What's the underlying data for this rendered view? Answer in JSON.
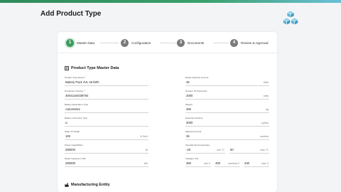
{
  "page": {
    "title": "Add Product Type"
  },
  "colors": {
    "accent": "#3d9b5f",
    "inactive_step": "#7a7a7a",
    "logo": "#5fb3d3"
  },
  "logo": {
    "icon": "cubes-icon"
  },
  "steps": [
    {
      "number": "1",
      "label": "Master Data",
      "active": true
    },
    {
      "number": "2",
      "label": "Configuration",
      "active": false
    },
    {
      "number": "3",
      "label": "Documents",
      "active": false
    },
    {
      "number": "4",
      "label": "Review & Approval",
      "active": false
    }
  ],
  "master_section": {
    "title": "Product Type Master Data",
    "icon": "grid-icon"
  },
  "fields": {
    "product_type_name": {
      "label": "Product Type Name *",
      "value": "Battery Pack 4VL 45 kWh"
    },
    "production_number": {
      "label": "Production Number *",
      "value": "30041164038784"
    },
    "battery_application_type": {
      "label": "Battery Application Type",
      "value": "Automotive"
    },
    "battery_chemistry_type": {
      "label": "Battery Chemistry Type",
      "value": "Li"
    },
    "state_of_health": {
      "label": "State Of Health",
      "value": "100",
      "unit": "% SoH"
    },
    "power_capabilities": {
      "label": "Power Capabilities",
      "value": "280000",
      "unit": "W"
    },
    "rated_capacity": {
      "label": "Rated Capacity in Wh",
      "value": "280000",
      "unit": "Wh"
    },
    "rated_capacity_current": {
      "label": "Rated Capacity Current",
      "value": "45",
      "unit": "kWh"
    },
    "number_of_total_cells": {
      "label": "Number Of Total Cells",
      "value": "2000",
      "unit": "cells"
    },
    "weight": {
      "label": "Weight",
      "value": "450",
      "unit": "kg"
    },
    "expected_lifetime": {
      "label": "Expected Lifetime",
      "value": "3000",
      "unit": "cycles"
    },
    "warranty_period": {
      "label": "Warranty Period",
      "value": "36",
      "unit": "months"
    },
    "operational_temperature": {
      "label": "Operational Temperature",
      "min": "-20",
      "min_unit": "min °C",
      "max": "60",
      "max_unit": "max °C"
    },
    "voltages_unit": {
      "label": "Voltages Unit",
      "min": "360",
      "min_unit": "min V",
      "nominal": "400",
      "nominal_unit": "nominal V",
      "max": "430",
      "max_unit": "max V"
    }
  },
  "manufacturing_section": {
    "title": "Manufacturing Entity",
    "icon": "factory-icon"
  }
}
